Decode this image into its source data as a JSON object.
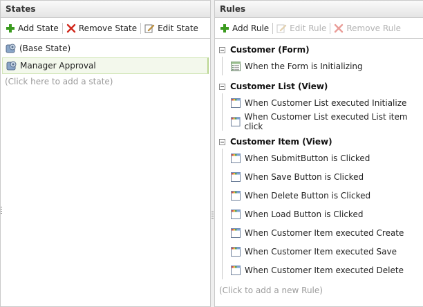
{
  "states_panel": {
    "title": "States",
    "toolbar": {
      "add_label": "Add State",
      "remove_label": "Remove State",
      "edit_label": "Edit State"
    },
    "items": [
      {
        "label": "(Base State)",
        "icon": "state-icon",
        "selected": false
      },
      {
        "label": "Manager Approval",
        "icon": "state-icon",
        "selected": true
      }
    ],
    "add_hint": "(Click here to add a state)"
  },
  "rules_panel": {
    "title": "Rules",
    "toolbar": {
      "add_label": "Add Rule",
      "edit_label": "Edit Rule",
      "remove_label": "Remove Rule"
    },
    "groups": [
      {
        "title": "Customer (Form)",
        "rules": [
          "When the Form is Initializing"
        ]
      },
      {
        "title": "Customer List (View)",
        "rules": [
          "When Customer List executed Initialize",
          "When Customer List executed List item click"
        ]
      },
      {
        "title": "Customer Item (View)",
        "rules": [
          "When SubmitButton is Clicked",
          "When Save Button is Clicked",
          "When Delete Button is Clicked",
          "When Load Button is Clicked",
          "When Customer Item executed Create",
          "When Customer Item executed Save",
          "When Customer Item executed Delete"
        ]
      }
    ],
    "add_hint": "(Click to add a new Rule)"
  },
  "colors": {
    "add_icon": "#3a9a1e",
    "remove_icon": "#d0281c",
    "selected_bg": "#f3f8ec"
  }
}
